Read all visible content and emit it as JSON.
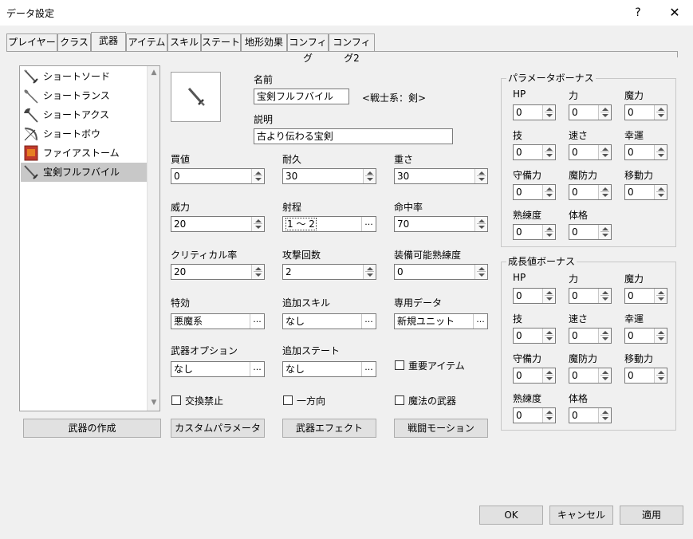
{
  "window": {
    "title": "データ設定",
    "help": "?",
    "close": "✕"
  },
  "tabs": [
    "プレイヤー",
    "クラス",
    "武器",
    "アイテム",
    "スキル",
    "ステート",
    "地形効果",
    "コンフィグ",
    "コンフィグ2"
  ],
  "active_tab": "武器",
  "weapon_list": {
    "items": [
      {
        "label": "ショートソード",
        "icon": "sword-icon"
      },
      {
        "label": "ショートランス",
        "icon": "lance-icon"
      },
      {
        "label": "ショートアクス",
        "icon": "axe-icon"
      },
      {
        "label": "ショートボウ",
        "icon": "bow-icon"
      },
      {
        "label": "ファイアストーム",
        "icon": "tome-icon"
      },
      {
        "label": "宝剣フルフバイル",
        "icon": "sword-icon"
      }
    ],
    "selected": "宝剣フルフバイル"
  },
  "detail": {
    "name_label": "名前",
    "name_value": "宝剣フルフバイル",
    "class_type": "<戦士系：剣>",
    "desc_label": "説明",
    "desc_value": "古より伝わる宝剣",
    "price_label": "買値",
    "price_value": "0",
    "durability_label": "耐久",
    "durability_value": "30",
    "weight_label": "重さ",
    "weight_value": "30",
    "power_label": "威力",
    "power_value": "20",
    "range_label": "射程",
    "range_value": "1 ～ 2",
    "hit_label": "命中率",
    "hit_value": "70",
    "crit_label": "クリティカル率",
    "crit_value": "20",
    "attacks_label": "攻撃回数",
    "attacks_value": "2",
    "mastery_label": "装備可能熟練度",
    "mastery_value": "0",
    "effective_label": "特効",
    "effective_value": "悪魔系",
    "addskill_label": "追加スキル",
    "addskill_value": "なし",
    "exclusive_label": "専用データ",
    "exclusive_value": "新規ユニット",
    "option_label": "武器オプション",
    "option_value": "なし",
    "addstate_label": "追加ステート",
    "addstate_value": "なし",
    "important_label": "重要アイテム",
    "notrade_label": "交換禁止",
    "oneway_label": "一方向",
    "magic_label": "魔法の武器",
    "ellipsis": "..."
  },
  "param_bonus": {
    "title": "パラメータボーナス",
    "fields": [
      {
        "label": "HP",
        "value": "0"
      },
      {
        "label": "力",
        "value": "0"
      },
      {
        "label": "魔力",
        "value": "0"
      },
      {
        "label": "技",
        "value": "0"
      },
      {
        "label": "速さ",
        "value": "0"
      },
      {
        "label": "幸運",
        "value": "0"
      },
      {
        "label": "守備力",
        "value": "0"
      },
      {
        "label": "魔防力",
        "value": "0"
      },
      {
        "label": "移動力",
        "value": "0"
      },
      {
        "label": "熟練度",
        "value": "0"
      },
      {
        "label": "体格",
        "value": "0"
      }
    ]
  },
  "growth_bonus": {
    "title": "成長値ボーナス",
    "fields": [
      {
        "label": "HP",
        "value": "0"
      },
      {
        "label": "力",
        "value": "0"
      },
      {
        "label": "魔力",
        "value": "0"
      },
      {
        "label": "技",
        "value": "0"
      },
      {
        "label": "速さ",
        "value": "0"
      },
      {
        "label": "幸運",
        "value": "0"
      },
      {
        "label": "守備力",
        "value": "0"
      },
      {
        "label": "魔防力",
        "value": "0"
      },
      {
        "label": "移動力",
        "value": "0"
      },
      {
        "label": "熟練度",
        "value": "0"
      },
      {
        "label": "体格",
        "value": "0"
      }
    ]
  },
  "buttons": {
    "create_weapon": "武器の作成",
    "custom_param": "カスタムパラメータ",
    "weapon_effect": "武器エフェクト",
    "battle_motion": "戦闘モーション",
    "ok": "OK",
    "cancel": "キャンセル",
    "apply": "適用"
  }
}
